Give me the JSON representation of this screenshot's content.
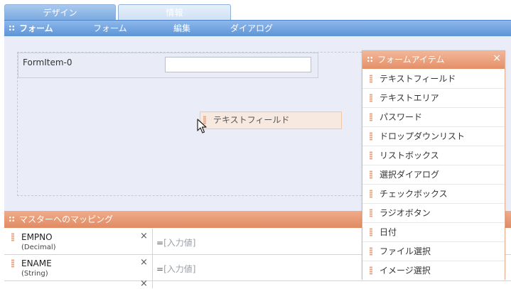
{
  "tabs": [
    {
      "label": "デザイン",
      "active": true
    },
    {
      "label": "情報",
      "active": false
    }
  ],
  "toolbar": {
    "title": "フォーム",
    "items": [
      "フォーム",
      "編集",
      "ダイアログ"
    ]
  },
  "canvas": {
    "form_item_label": "FormItem-0",
    "form_item_value": "",
    "dragging_label": "テキストフィールド"
  },
  "mapping": {
    "title": "マスターへのマッピング",
    "rows": [
      {
        "name": "EMPNO",
        "type": "(Decimal)",
        "eq": "=",
        "value": "[入力値]"
      },
      {
        "name": "ENAME",
        "type": "(String)",
        "eq": "=",
        "value": "[入力値]"
      }
    ]
  },
  "palette": {
    "title": "フォームアイテム",
    "close": "×",
    "items": [
      "テキストフィールド",
      "テキストエリア",
      "パスワード",
      "ドロップダウンリスト",
      "リストボックス",
      "選択ダイアログ",
      "チェックボックス",
      "ラジオボタン",
      "日付",
      "ファイル選択",
      "イメージ選択"
    ]
  },
  "colors": {
    "toolbar": "#6fa3e0",
    "accent_orange": "#e48f68",
    "canvas_bg": "#eaedf7"
  }
}
